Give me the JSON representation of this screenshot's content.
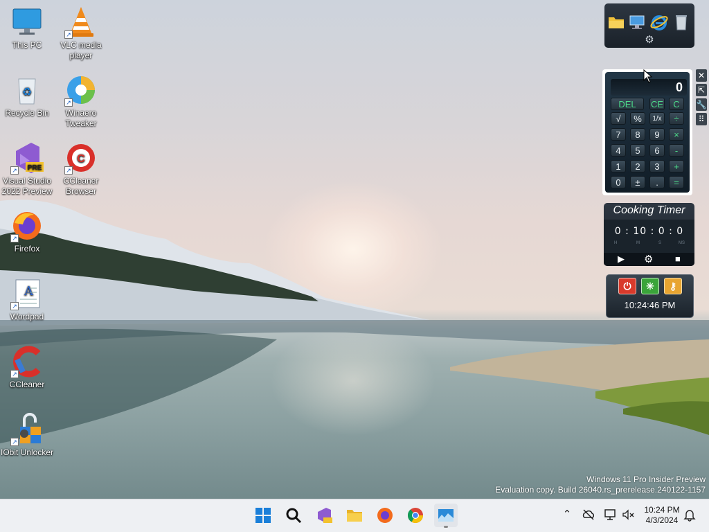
{
  "desktop": {
    "icons": [
      {
        "label": "This PC",
        "icon": "monitor-icon"
      },
      {
        "label": "VLC media player",
        "icon": "vlc-cone-icon"
      },
      {
        "label": "Recycle Bin",
        "icon": "recycle-bin-icon"
      },
      {
        "label": "Winaero Tweaker",
        "icon": "winaero-tweaker-icon"
      },
      {
        "label": "Visual Studio 2022 Preview",
        "icon": "visual-studio-icon",
        "badge": "PRE"
      },
      {
        "label": "CCleaner Browser",
        "icon": "ccleaner-browser-icon"
      },
      {
        "label": "Firefox",
        "icon": "firefox-icon"
      },
      {
        "label": "Wordpad",
        "icon": "wordpad-icon"
      },
      {
        "label": "CCleaner",
        "icon": "ccleaner-icon"
      },
      {
        "label": "IObit Unlocker",
        "icon": "iobit-unlocker-icon"
      }
    ]
  },
  "gadgets": {
    "calculator": {
      "display": "0",
      "keys": [
        "DEL",
        "CE",
        "C",
        "√",
        "%",
        "1/x",
        "÷",
        "7",
        "8",
        "9",
        "×",
        "4",
        "5",
        "6",
        "-",
        "1",
        "2",
        "3",
        "+",
        "0",
        "±",
        ".",
        "="
      ]
    },
    "calculator_sidebar": [
      "✕",
      "⇱",
      "🔧",
      "⠿"
    ],
    "cooking_timer": {
      "title": "Cooking Timer",
      "display": "0 : 10 : 0 : 0",
      "units": [
        "H",
        "M",
        "S",
        "MS"
      ]
    },
    "shutdown_clock": {
      "time": "10:24:46 PM"
    }
  },
  "watermark": {
    "line1": "Windows 11 Pro Insider Preview",
    "line2": "Evaluation copy. Build 26040.rs_prerelease.240122-1157"
  },
  "taskbar": {
    "apps": [
      "start-icon",
      "search-icon",
      "visual-studio-icon",
      "file-explorer-icon",
      "firefox-icon",
      "chrome-icon",
      "gadgets-icon"
    ],
    "tray": {
      "time": "10:24 PM",
      "date": "4/3/2024"
    }
  },
  "colors": {
    "taskbar_bg": "#eef0f3",
    "gadget_dark": "#1a2129",
    "calc_green": "#4ddc8a"
  }
}
